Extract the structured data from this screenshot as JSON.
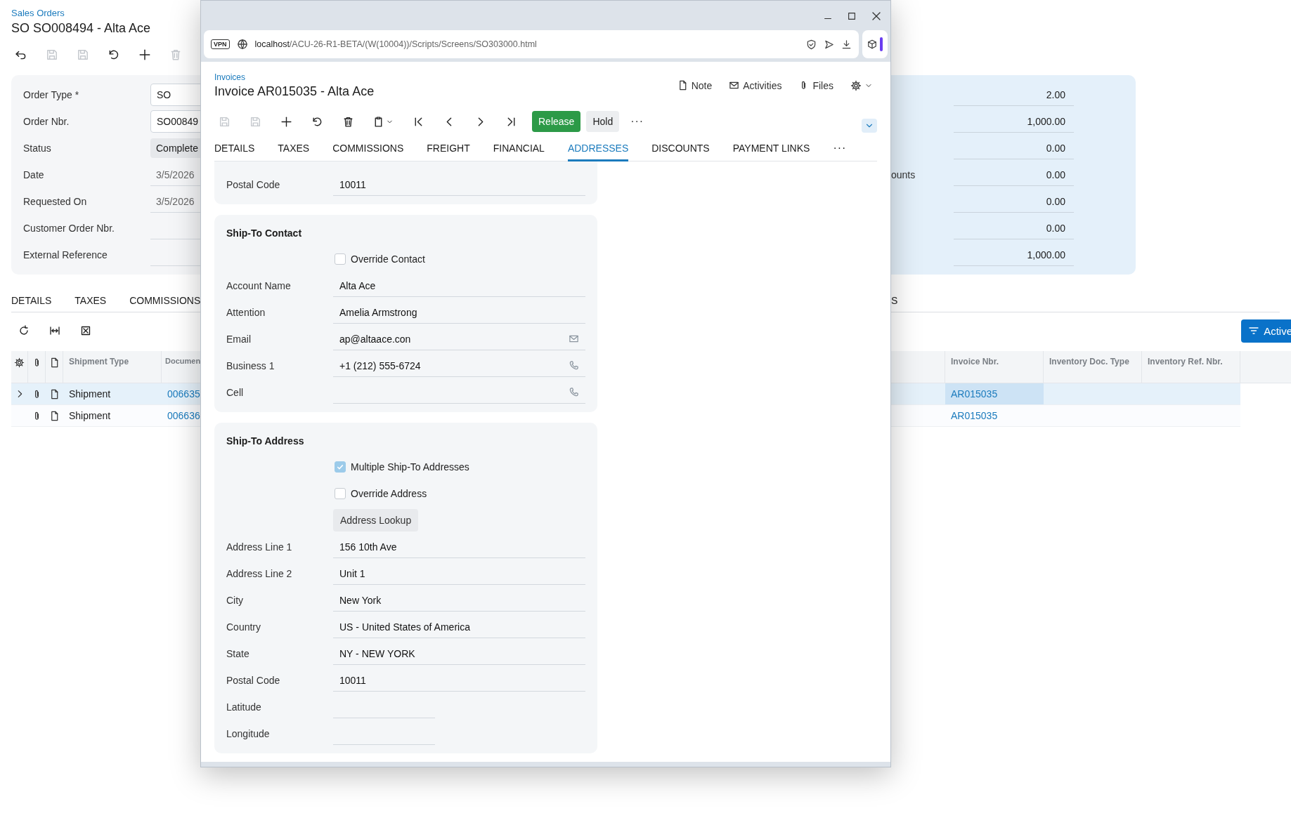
{
  "background_page": {
    "breadcrumb": "Sales Orders",
    "title": "SO SO008494 - Alta Ace",
    "toolbar": [
      {
        "kind": "back",
        "disabled": false
      },
      {
        "kind": "save_close",
        "disabled": true
      },
      {
        "kind": "save",
        "disabled": true
      },
      {
        "kind": "undo",
        "disabled": false
      },
      {
        "kind": "add",
        "disabled": false
      },
      {
        "kind": "delete",
        "disabled": true
      }
    ],
    "summary_fields": [
      {
        "label": "Order Type *",
        "kind": "box",
        "value": "SO"
      },
      {
        "label": "Order Nbr.",
        "kind": "box",
        "value": "SO00849"
      },
      {
        "label": "Status",
        "kind": "pill",
        "value": "Complete"
      },
      {
        "label": "Date",
        "kind": "line",
        "value": "3/5/2026"
      },
      {
        "label": "Requested On",
        "kind": "line",
        "value": "3/5/2026"
      },
      {
        "label": "Customer Order Nbr.",
        "kind": "line"
      },
      {
        "label": "External Reference",
        "kind": "line"
      }
    ],
    "summary_totals": [
      {
        "value": "2.00"
      },
      {
        "value": "1,000.00"
      },
      {
        "value": "0.00"
      },
      {
        "label": "ounts",
        "value": "0.00"
      },
      {
        "value": "0.00"
      },
      {
        "value": "0.00"
      },
      {
        "value": "1,000.00"
      }
    ],
    "tabs": [
      "DETAILS",
      "TAXES",
      "COMMISSIONS"
    ],
    "tab_right": "S",
    "filter_button": "Active",
    "grid": {
      "columns_left": [
        "Shipment Type",
        "Documen"
      ],
      "columns_right": [
        "Invoice Nbr.",
        "Inventory Doc. Type",
        "Inventory Ref. Nbr."
      ],
      "rows": [
        {
          "selected": true,
          "expandable": true,
          "shipment_type": "Shipment",
          "document": "006635",
          "invoice_nbr": "AR015035"
        },
        {
          "selected": false,
          "expandable": false,
          "shipment_type": "Shipment",
          "document": "006636",
          "invoice_nbr": "AR015035"
        }
      ]
    }
  },
  "popup": {
    "vpn": "VPN",
    "url_host": "localhost",
    "url_path": "/ACU-26-R1-BETA/(W(10004))/Scripts/Screens/SO303000.html",
    "breadcrumb": "Invoices",
    "title": "Invoice AR015035 - Alta Ace",
    "header_actions": [
      {
        "kind": "note",
        "label": "Note"
      },
      {
        "kind": "activities",
        "label": "Activities"
      },
      {
        "kind": "files",
        "label": "Files"
      }
    ],
    "toolbar": [
      {
        "kind": "save_close",
        "disabled": true
      },
      {
        "kind": "save",
        "disabled": true
      },
      {
        "kind": "add",
        "disabled": false
      },
      {
        "kind": "undo",
        "disabled": false
      },
      {
        "kind": "delete",
        "disabled": false
      },
      {
        "kind": "clipboard",
        "disabled": false
      },
      {
        "kind": "first",
        "disabled": false
      },
      {
        "kind": "prev",
        "disabled": false
      },
      {
        "kind": "next",
        "disabled": false
      },
      {
        "kind": "last",
        "disabled": false
      }
    ],
    "buttons": [
      {
        "kind": "primary",
        "label": "Release"
      },
      {
        "kind": "secondary",
        "label": "Hold"
      }
    ],
    "toolbar_more": "···",
    "tabs": [
      {
        "label": "DETAILS",
        "selected": false
      },
      {
        "label": "TAXES",
        "selected": false
      },
      {
        "label": "COMMISSIONS",
        "selected": false
      },
      {
        "label": "FREIGHT",
        "selected": false
      },
      {
        "label": "FINANCIAL",
        "selected": false
      },
      {
        "label": "ADDRESSES",
        "selected": true
      },
      {
        "label": "DISCOUNTS",
        "selected": false
      },
      {
        "label": "PAYMENT LINKS",
        "selected": false
      }
    ],
    "tabs_more": "···",
    "sections": [
      {
        "rows": [
          {
            "kind": "field",
            "label": "Postal Code",
            "value": "10011"
          }
        ]
      },
      {
        "title": "Ship-To Contact",
        "rows": [
          {
            "kind": "checkbox",
            "label": "Override Contact",
            "checked": false
          },
          {
            "kind": "field",
            "label": "Account Name",
            "value": "Alta Ace"
          },
          {
            "kind": "field",
            "label": "Attention",
            "value": "Amelia Armstrong"
          },
          {
            "kind": "email_field",
            "label": "Email",
            "value": "ap@altaace.con"
          },
          {
            "kind": "phone_field",
            "label": "Business 1",
            "value": "+1 (212) 555-6724"
          },
          {
            "kind": "phone_field",
            "label": "Cell"
          }
        ]
      },
      {
        "title": "Ship-To Address",
        "rows": [
          {
            "kind": "checkbox",
            "label": "Multiple Ship-To Addresses",
            "checked": true
          },
          {
            "kind": "checkbox",
            "label": "Override Address",
            "checked": false
          },
          {
            "kind": "button",
            "label": "Address Lookup"
          },
          {
            "kind": "field",
            "label": "Address Line 1",
            "value": "156 10th Ave"
          },
          {
            "kind": "field",
            "label": "Address Line 2",
            "value": "Unit 1"
          },
          {
            "kind": "field",
            "label": "City",
            "value": "New York"
          },
          {
            "kind": "field",
            "label": "Country",
            "value": "US - United States of America"
          },
          {
            "kind": "field",
            "label": "State",
            "value": "NY - NEW YORK"
          },
          {
            "kind": "field",
            "label": "Postal Code",
            "value": "10011"
          },
          {
            "kind": "short_field",
            "label": "Latitude"
          },
          {
            "kind": "short_field",
            "label": "Longitude"
          }
        ]
      }
    ]
  }
}
